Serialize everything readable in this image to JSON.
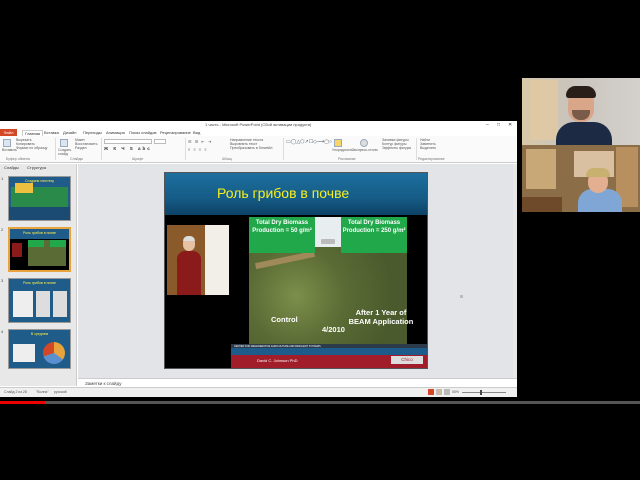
{
  "window": {
    "title": "1 часть - Microsoft PowerPoint (Сбой активации продукта)",
    "controls": [
      "–",
      "□",
      "✕"
    ]
  },
  "ribbon_tabs": [
    "Файл",
    "Главная",
    "Вставка",
    "Дизайн",
    "Переходы",
    "Анимация",
    "Показ слайдов",
    "Рецензирование",
    "Вид"
  ],
  "ribbon": {
    "clipboard": [
      "Вырезать",
      "Копировать",
      "Формат по образцу"
    ],
    "clipboard_paste": "Вставить",
    "clipboard_label": "Буфер обмена",
    "slides": [
      "Макет",
      "Восстановить",
      "Раздел"
    ],
    "slides_new": "Создать слайд",
    "slides_label": "Слайды",
    "font_label": "Шрифт",
    "paragraph": [
      "Направление текста",
      "Выровнять текст",
      "Преобразовать в SmartArt"
    ],
    "paragraph_label": "Абзац",
    "drawing": [
      "Упорядочить",
      "Экспресс-стили",
      "Заливка фигуры",
      "Контур фигуры",
      "Эффекты фигуры"
    ],
    "drawing_label": "Рисование",
    "editing": [
      "Найти",
      "Заменить",
      "Выделить"
    ],
    "editing_label": "Редактирование"
  },
  "side_panel": {
    "tabs": [
      "Слайды",
      "Структура"
    ],
    "thumbnails": [
      {
        "num": "1",
        "title": "Создаем гипотезу"
      },
      {
        "num": "2",
        "title": "Роль грибов в почве"
      },
      {
        "num": "3",
        "title": "Роль грибов в почве"
      },
      {
        "num": "4",
        "title": "В среднем"
      }
    ]
  },
  "slide": {
    "title": "Роль грибов в почве",
    "box_left": "Total Dry Biomass Production = 50 g/m²",
    "box_right": "Total Dry Biomass Production = 250 g/m²",
    "control": "Control",
    "beam": "After 1 Year of BEAM Application",
    "date": "4/2010",
    "center": "CENTER FOR REGENERATIVE AGRICULTURE AND RESILIENT SYSTEMS",
    "author": "David C. Johnson PhD",
    "logo": "Chico"
  },
  "notes_placeholder": "Заметки к слайду",
  "statusbar": {
    "left": "Слайд 2 из 28",
    "theme": "\"Волна\"",
    "lang": "русский",
    "zoom": "55%"
  },
  "progress": 0.07,
  "colors": {
    "ppt_accent": "#d24726",
    "slide_title": "#f7f01f",
    "slide_header": "#1d6e9e",
    "green_box": "#20a84a"
  }
}
